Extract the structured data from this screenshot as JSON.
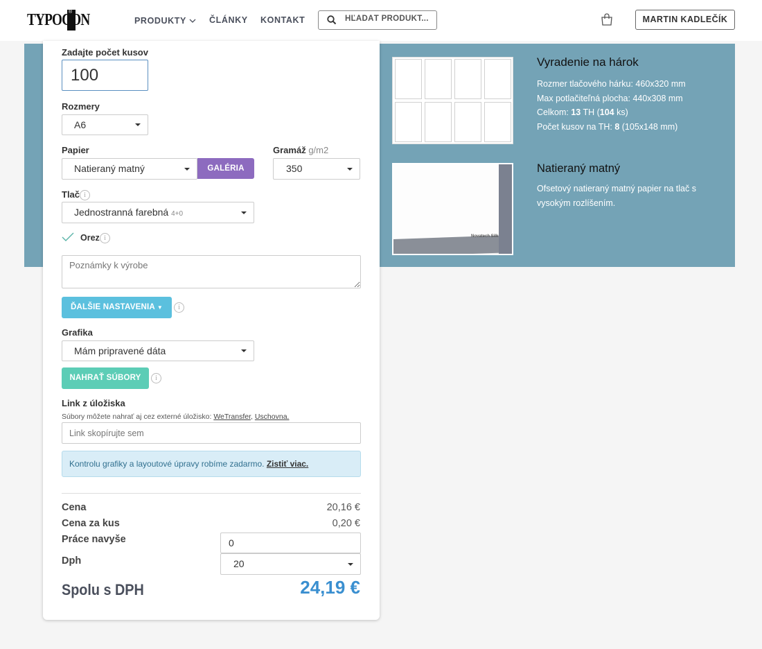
{
  "header": {
    "logo": "TYPOCON",
    "nav": {
      "products": "PRODUKTY",
      "articles": "ČLÁNKY",
      "contact": "KONTAKT"
    },
    "search": {
      "placeholder": "HĽADAŤ PRODUKT..."
    },
    "user": "MARTIN KADLEČÍK"
  },
  "form": {
    "quantity_label": "Zadajte počet kusov",
    "quantity_value": "100",
    "size_label": "Rozmery",
    "size_value": "A6",
    "paper_label": "Papier",
    "paper_value": "Natieraný matný",
    "gallery_button": "GALÉRIA",
    "weight_label": "Gramáž",
    "weight_unit": "g/m2",
    "weight_value": "350",
    "print_label": "Tlač",
    "print_value": "Jednostranná farebná",
    "print_suffix": "4+0",
    "crop_label": "Orez",
    "crop_checked": true,
    "notes_placeholder": "Poznámky k výrobe",
    "more_settings_button": "ĎALŠIE NASTAVENIA",
    "graphics_label": "Grafika",
    "graphics_value": "Mám pripravené dáta",
    "upload_button": "NAHRAŤ SÚBORY",
    "storage_label": "Link z úložiska",
    "storage_hint": "Súbory môžete nahrať aj cez externé úložisko:",
    "storage_link1": "WeTransfer",
    "storage_sep": ",",
    "storage_link2": "Uschovna.",
    "storage_placeholder": "Link skopírujte sem",
    "notice_text": "Kontrolu grafiky a layoutové úpravy robíme zadarmo.",
    "notice_link": "Zistiť viac."
  },
  "pricing": {
    "price_label": "Cena",
    "price_value": "20,16 €",
    "unit_price_label": "Cena za kus",
    "unit_price_value": "0,20 €",
    "extra_work_label": "Práce navyše",
    "extra_work_value": "0",
    "vat_label": "Dph",
    "vat_value": "20",
    "total_label": "Spolu s DPH",
    "total_value": "24,19 €"
  },
  "layout_info": {
    "title": "Vyradenie na hárok",
    "line1": "Rozmer tlačového hárku: 460x320 mm",
    "line2": "Max potlačiteľná plocha: 440x308 mm",
    "line3_pre": "Celkom: ",
    "line3_th": "13",
    "line3_mid": " TH (",
    "line3_pcs": "104",
    "line3_post": " ks)",
    "line4_pre": "Počet kusov na TH: ",
    "line4_num": "8",
    "line4_post": " (105x148 mm)"
  },
  "paper_info": {
    "title": "Natieraný matný",
    "desc1": "Ofsetový natieraný matný papier na tlač s",
    "desc2": "vysokým rozlíšením.",
    "image_text": "Novatech Silk"
  },
  "colors": {
    "band": "#74a3b6",
    "gallery": "#8d6bbf",
    "more_settings": "#5bc0de",
    "upload": "#5ccdb6",
    "total": "#3a8fd0",
    "notice_bg": "#d9edf7"
  }
}
